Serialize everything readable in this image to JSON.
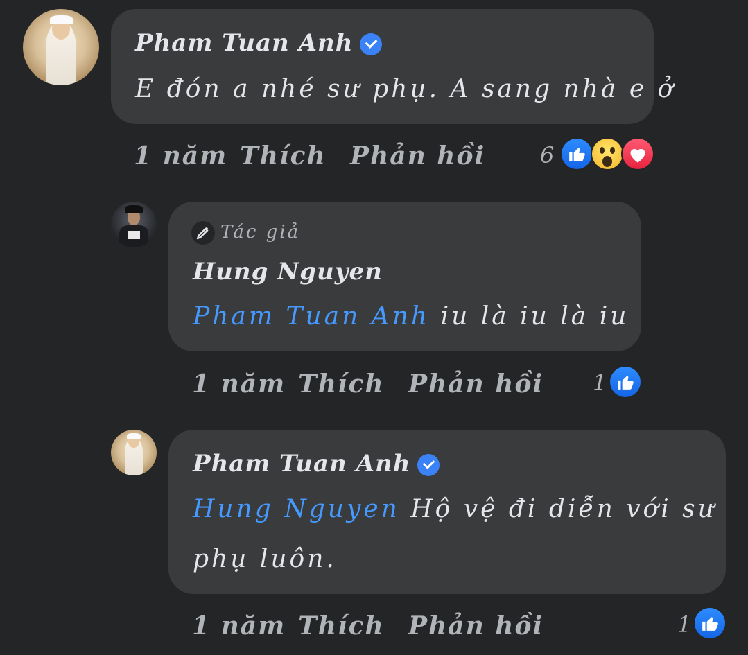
{
  "comments": [
    {
      "author": "Pham Tuan Anh",
      "verified": true,
      "text": "E đón a nhé sư phụ. A sang nhà e ở",
      "time": "1 năm",
      "like_label": "Thích",
      "reply_label": "Phản hồi",
      "reaction_count": "6",
      "reactions": [
        "like-icon",
        "wow-icon",
        "love-icon"
      ]
    },
    {
      "author": "Hung Nguyen",
      "badge": "Tác giả",
      "verified": false,
      "mention": "Pham Tuan Anh",
      "text": "iu là iu là iu",
      "time": "1 năm",
      "like_label": "Thích",
      "reply_label": "Phản hồi",
      "reaction_count": "1",
      "reactions": [
        "like-icon"
      ]
    },
    {
      "author": "Pham Tuan Anh",
      "verified": true,
      "mention": "Hung Nguyen",
      "text_line1": "Hộ vệ đi diễn với sư",
      "text_line2": "phụ luôn.",
      "time": "1 năm",
      "like_label": "Thích",
      "reply_label": "Phản hồi",
      "reaction_count": "1",
      "reactions": [
        "like-icon"
      ]
    }
  ],
  "colors": {
    "background": "#242526",
    "bubble": "#3a3b3c",
    "mention": "#4599ff",
    "verified": "#3b82f6"
  }
}
